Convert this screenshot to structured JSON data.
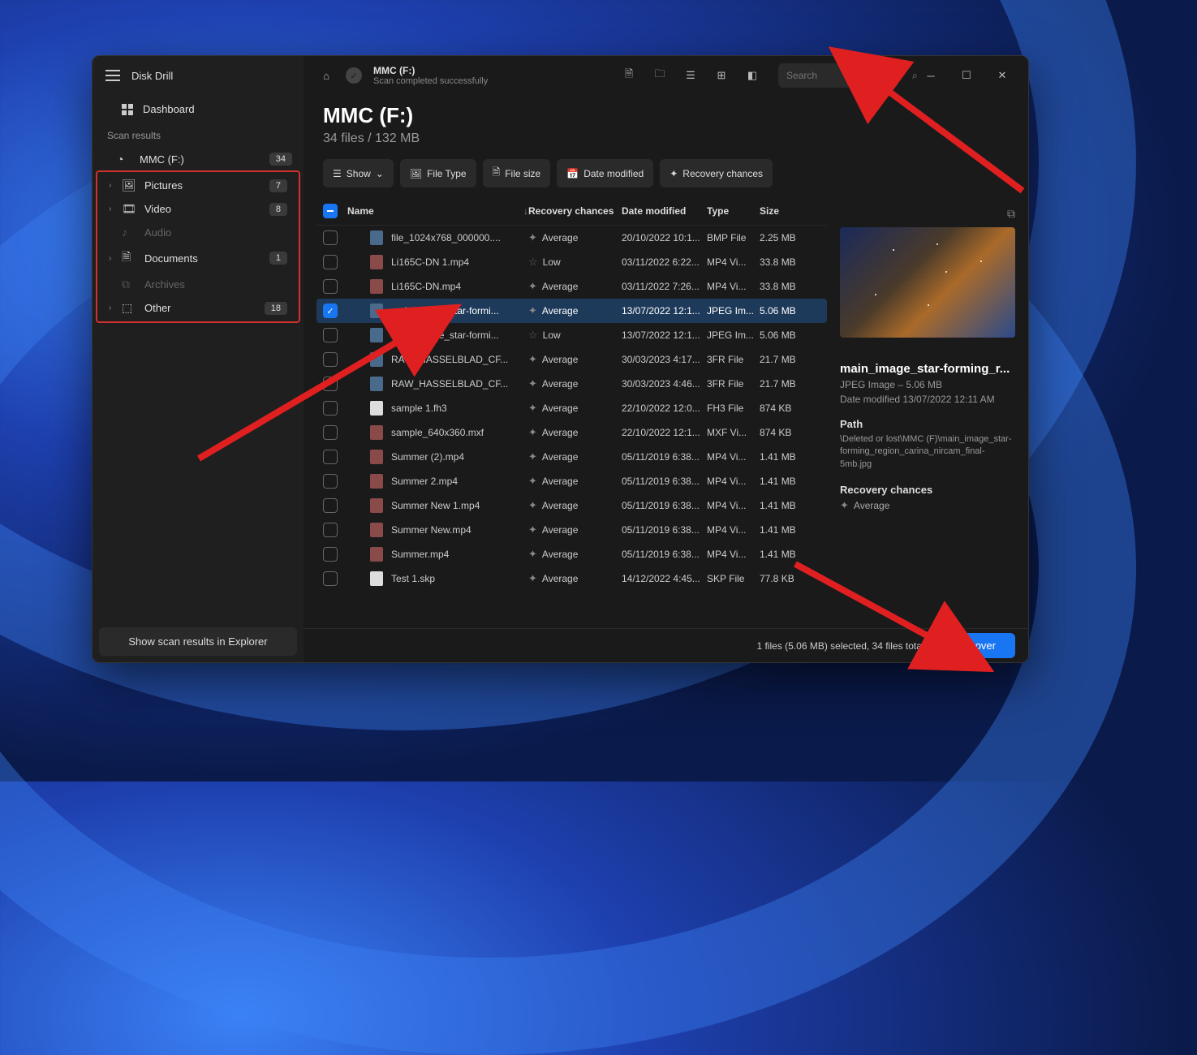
{
  "app": {
    "title": "Disk Drill"
  },
  "nav": {
    "dashboard": "Dashboard",
    "section_label": "Scan results",
    "root": {
      "label": "MMC (F:)",
      "badge": "34"
    },
    "items": [
      {
        "label": "Pictures",
        "badge": "7",
        "icon": "picture"
      },
      {
        "label": "Video",
        "badge": "8",
        "icon": "video"
      },
      {
        "label": "Audio",
        "badge": "",
        "icon": "audio",
        "disabled": true,
        "no_chev": true
      },
      {
        "label": "Documents",
        "badge": "1",
        "icon": "document"
      },
      {
        "label": "Archives",
        "badge": "",
        "icon": "archive",
        "disabled": true,
        "no_chev": true
      },
      {
        "label": "Other",
        "badge": "18",
        "icon": "other"
      }
    ]
  },
  "footer_button": "Show scan results in Explorer",
  "titlebar": {
    "drive": "MMC (F:)",
    "status": "Scan completed successfully",
    "search_placeholder": "Search"
  },
  "header": {
    "title": "MMC (F:)",
    "subtitle": "34 files / 132 MB"
  },
  "filters": {
    "show": "Show",
    "file_type": "File Type",
    "file_size": "File size",
    "date_modified": "Date modified",
    "recovery_chances": "Recovery chances"
  },
  "columns": {
    "name": "Name",
    "recovery": "Recovery chances",
    "date": "Date modified",
    "type": "Type",
    "size": "Size"
  },
  "rows": [
    {
      "name": "file_1024x768_000000....",
      "rec": "Average",
      "date": "20/10/2022 10:1...",
      "type": "BMP File",
      "size": "2.25 MB",
      "icon": "img",
      "star": "half"
    },
    {
      "name": "Li165C-DN 1.mp4",
      "rec": "Low",
      "date": "03/11/2022 6:22...",
      "type": "MP4 Vi...",
      "size": "33.8 MB",
      "icon": "vid",
      "star": "empty"
    },
    {
      "name": "Li165C-DN.mp4",
      "rec": "Average",
      "date": "03/11/2022 7:26...",
      "type": "MP4 Vi...",
      "size": "33.8 MB",
      "icon": "vid",
      "star": "half"
    },
    {
      "name": "main_image_star-formi...",
      "rec": "Average",
      "date": "13/07/2022 12:1...",
      "type": "JPEG Im...",
      "size": "5.06 MB",
      "icon": "img",
      "star": "half",
      "selected": true,
      "checked": true
    },
    {
      "name": "main_image_star-formi...",
      "rec": "Low",
      "date": "13/07/2022 12:1...",
      "type": "JPEG Im...",
      "size": "5.06 MB",
      "icon": "img",
      "star": "empty"
    },
    {
      "name": "RAW_HASSELBLAD_CF...",
      "rec": "Average",
      "date": "30/03/2023 4:17...",
      "type": "3FR File",
      "size": "21.7 MB",
      "icon": "img",
      "star": "half"
    },
    {
      "name": "RAW_HASSELBLAD_CF...",
      "rec": "Average",
      "date": "30/03/2023 4:46...",
      "type": "3FR File",
      "size": "21.7 MB",
      "icon": "img",
      "star": "half"
    },
    {
      "name": "sample 1.fh3",
      "rec": "Average",
      "date": "22/10/2022 12:0...",
      "type": "FH3 File",
      "size": "874 KB",
      "icon": "doc",
      "star": "half"
    },
    {
      "name": "sample_640x360.mxf",
      "rec": "Average",
      "date": "22/10/2022 12:1...",
      "type": "MXF Vi...",
      "size": "874 KB",
      "icon": "vid",
      "star": "half"
    },
    {
      "name": "Summer (2).mp4",
      "rec": "Average",
      "date": "05/11/2019 6:38...",
      "type": "MP4 Vi...",
      "size": "1.41 MB",
      "icon": "vid",
      "star": "half"
    },
    {
      "name": "Summer 2.mp4",
      "rec": "Average",
      "date": "05/11/2019 6:38...",
      "type": "MP4 Vi...",
      "size": "1.41 MB",
      "icon": "vid",
      "star": "half"
    },
    {
      "name": "Summer New 1.mp4",
      "rec": "Average",
      "date": "05/11/2019 6:38...",
      "type": "MP4 Vi...",
      "size": "1.41 MB",
      "icon": "vid",
      "star": "half"
    },
    {
      "name": "Summer New.mp4",
      "rec": "Average",
      "date": "05/11/2019 6:38...",
      "type": "MP4 Vi...",
      "size": "1.41 MB",
      "icon": "vid",
      "star": "half"
    },
    {
      "name": "Summer.mp4",
      "rec": "Average",
      "date": "05/11/2019 6:38...",
      "type": "MP4 Vi...",
      "size": "1.41 MB",
      "icon": "vid",
      "star": "half"
    },
    {
      "name": "Test 1.skp",
      "rec": "Average",
      "date": "14/12/2022 4:45...",
      "type": "SKP File",
      "size": "77.8 KB",
      "icon": "doc",
      "star": "half"
    }
  ],
  "preview": {
    "name": "main_image_star-forming_r...",
    "meta1": "JPEG Image – 5.06 MB",
    "meta2": "Date modified 13/07/2022 12:11 AM",
    "path_label": "Path",
    "path_value": "\\Deleted or lost\\MMC (F)\\main_image_star-forming_region_carina_nircam_final-5mb.jpg",
    "rec_label": "Recovery chances",
    "rec_value": "Average"
  },
  "status": {
    "text": "1 files (5.06 MB) selected, 34 files total",
    "recover": "Recover"
  }
}
